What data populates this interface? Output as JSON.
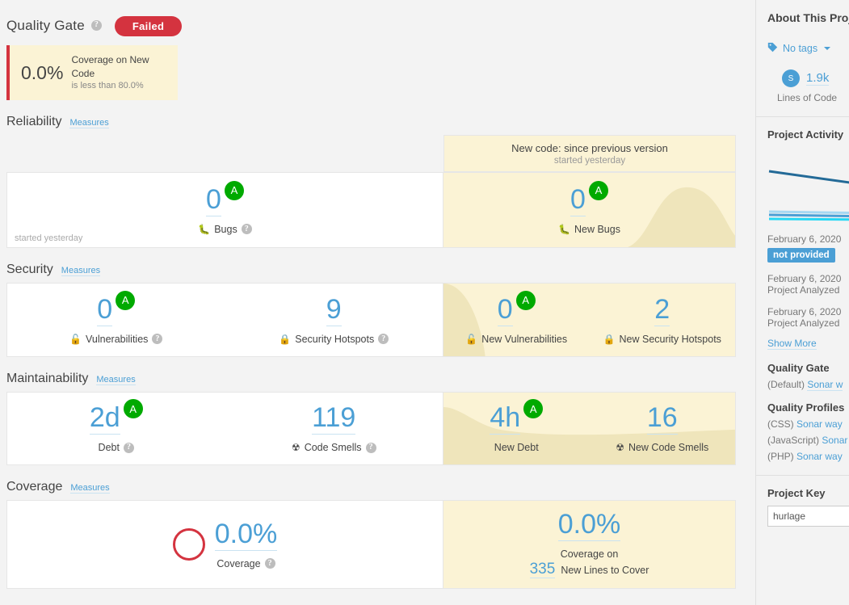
{
  "quality_gate": {
    "title": "Quality Gate",
    "help_icon": "help-icon",
    "status": "Failed",
    "status_color": "#d4333f",
    "condition": {
      "value": "0.0%",
      "name": "Coverage on New Code",
      "detail": "is less than 80.0%"
    }
  },
  "new_code": {
    "title": "New code: since previous version",
    "subtitle": "started yesterday",
    "background": "#fbf3d5"
  },
  "sections": [
    {
      "title": "Reliability",
      "link": "Measures",
      "footer": "started yesterday",
      "left": [
        {
          "value": "0",
          "label": "Bugs",
          "icon": "bug-icon",
          "rating": "A",
          "rating_color": "#00aa00",
          "help": true
        }
      ],
      "right": [
        {
          "value": "0",
          "label": "New Bugs",
          "icon": "bug-icon",
          "rating": "A",
          "rating_color": "#00aa00",
          "help": false
        }
      ]
    },
    {
      "title": "Security",
      "link": "Measures",
      "footer": "",
      "left": [
        {
          "value": "0",
          "label": "Vulnerabilities",
          "icon": "open-lock-icon",
          "rating": "A",
          "rating_color": "#00aa00",
          "help": true
        },
        {
          "value": "9",
          "label": "Security Hotspots",
          "icon": "lock-icon",
          "rating": "",
          "rating_color": "",
          "help": true
        }
      ],
      "right": [
        {
          "value": "0",
          "label": "New Vulnerabilities",
          "icon": "open-lock-icon",
          "rating": "A",
          "rating_color": "#00aa00",
          "help": false
        },
        {
          "value": "2",
          "label": "New Security Hotspots",
          "icon": "lock-icon",
          "rating": "",
          "rating_color": "",
          "help": false
        }
      ]
    },
    {
      "title": "Maintainability",
      "link": "Measures",
      "footer": "",
      "left": [
        {
          "value": "2d",
          "label": "Debt",
          "icon": "",
          "rating": "A",
          "rating_color": "#00aa00",
          "help": true
        },
        {
          "value": "119",
          "label": "Code Smells",
          "icon": "code-smell-icon",
          "rating": "",
          "rating_color": "",
          "help": true
        }
      ],
      "right": [
        {
          "value": "4h",
          "label": "New Debt",
          "icon": "",
          "rating": "A",
          "rating_color": "#00aa00",
          "help": false
        },
        {
          "value": "16",
          "label": "New Code Smells",
          "icon": "code-smell-icon",
          "rating": "",
          "rating_color": "",
          "help": false
        }
      ]
    }
  ],
  "coverage": {
    "title": "Coverage",
    "link": "Measures",
    "donut_color": "#d4333f",
    "value": "0.0%",
    "label": "Coverage",
    "new": {
      "value": "0.0%",
      "label_line1": "Coverage on",
      "lines_number": "335",
      "label_line2": "New Lines to Cover"
    }
  },
  "sidebar": {
    "about_title": "About This Proje",
    "tags": {
      "icon": "tag-icon",
      "label": "No tags"
    },
    "lines_of_code": {
      "lang_initial": "S",
      "value": "1.9k",
      "label": "Lines of Code"
    },
    "project_activity": {
      "title": "Project Activity",
      "events": [
        {
          "date": "February 6, 2020",
          "type": "",
          "version": "not provided"
        },
        {
          "date": "February 6, 2020",
          "type": "Project Analyzed",
          "version": ""
        },
        {
          "date": "February 6, 2020",
          "type": "Project Analyzed",
          "version": ""
        }
      ],
      "show_more": "Show More"
    },
    "quality_gate": {
      "title": "Quality Gate",
      "default_label": "(Default)",
      "value": "Sonar w"
    },
    "quality_profiles": {
      "title": "Quality Profiles",
      "items": [
        {
          "lang": "(CSS)",
          "profile": "Sonar way"
        },
        {
          "lang": "(JavaScript)",
          "profile": "Sonar"
        },
        {
          "lang": "(PHP)",
          "profile": "Sonar way"
        }
      ]
    },
    "project_key": {
      "title": "Project Key",
      "value": "hurlage"
    }
  }
}
